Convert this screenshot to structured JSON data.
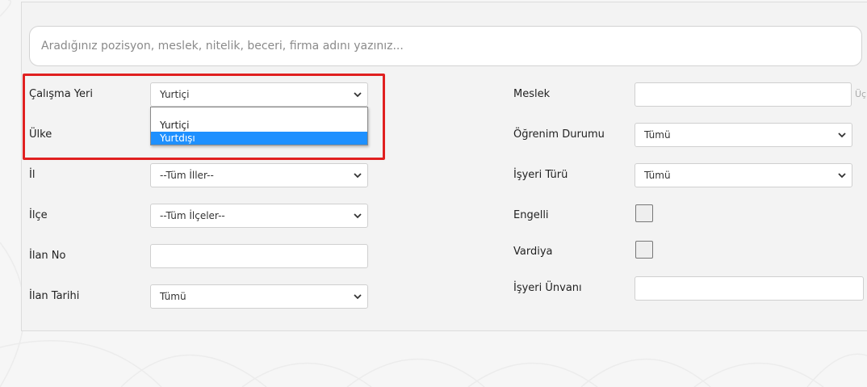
{
  "search": {
    "placeholder": "Aradığınız pozisyon, meslek, nitelik, beceri, firma adını yazınız..."
  },
  "left": {
    "calisma_yeri": {
      "label": "Çalışma Yeri",
      "value": "Yurtiçi"
    },
    "ulke": {
      "label": "Ülke"
    },
    "il": {
      "label": "İl",
      "value": "--Tüm İller--"
    },
    "ilce": {
      "label": "İlçe",
      "value": "--Tüm İlçeler--"
    },
    "ilan_no": {
      "label": "İlan No",
      "value": ""
    },
    "ilan_tarihi": {
      "label": "İlan Tarihi",
      "value": "Tümü"
    }
  },
  "dropdown": {
    "options": [
      "Yurtiçi",
      "Yurtdışı"
    ],
    "highlighted": "Yurtdışı"
  },
  "right": {
    "meslek": {
      "label": "Meslek",
      "value": "",
      "cut_text": "Üç"
    },
    "ogrenim": {
      "label": "Öğrenim Durumu",
      "value": "Tümü"
    },
    "isyeri_turu": {
      "label": "İşyeri Türü",
      "value": "Tümü"
    },
    "engelli": {
      "label": "Engelli",
      "checked": false
    },
    "vardiya": {
      "label": "Vardiya",
      "checked": false
    },
    "isyeri_unvani": {
      "label": "İşyeri Ünvanı",
      "value": ""
    }
  },
  "colors": {
    "highlight_border": "#e02020",
    "selected_option": "#1e90ff"
  }
}
